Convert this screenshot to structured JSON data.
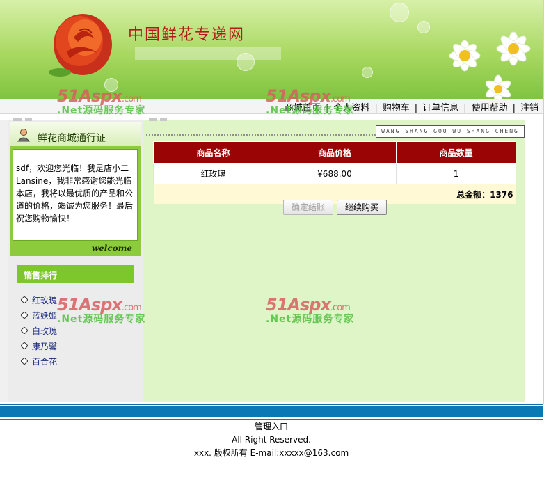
{
  "site": {
    "title": "中国鲜花专递网"
  },
  "nav": {
    "items": [
      {
        "label": "商城首页"
      },
      {
        "label": "个人资料"
      },
      {
        "label": "购物车"
      },
      {
        "label": "订单信息"
      },
      {
        "label": "使用帮助"
      },
      {
        "label": "注销"
      }
    ],
    "separator": "|"
  },
  "passport": {
    "title": "鲜花商城通行证",
    "message": "sdf，欢迎您光临！我是店小二Lansine，我非常感谢您能光临本店，我将以最优质的产品和公道的价格，竭诚为您服务！最后祝您购物愉快！",
    "welcome": "welcome"
  },
  "ranking": {
    "title": "销售排行",
    "items": [
      "红玫瑰",
      "蓝妖姬",
      "白玫瑰",
      "康乃馨",
      "百合花"
    ]
  },
  "slogan": "WANG SHANG GOU WU SHANG CHENG",
  "cart": {
    "headers": [
      "商品名称",
      "商品价格",
      "商品数量"
    ],
    "rows": [
      {
        "name": "红玫瑰",
        "price": "¥688.00",
        "qty": "1"
      }
    ],
    "total_label": "总金额：",
    "total_value": "1376"
  },
  "buttons": {
    "checkout": "确定结账",
    "continue": "继续购买"
  },
  "footer": {
    "admin": "管理入口",
    "rights": "All Right Reserved.",
    "copyright": "xxx. 版权所有 E-mail:xxxxx@163.com"
  },
  "watermark": {
    "logo": "51Aspx",
    "domain": ".com",
    "tagline": ".Net源码服务专家"
  },
  "colors": {
    "header_red": "#9b0404",
    "accent_green": "#7dc62c",
    "footer_blue": "#0a78b4"
  }
}
